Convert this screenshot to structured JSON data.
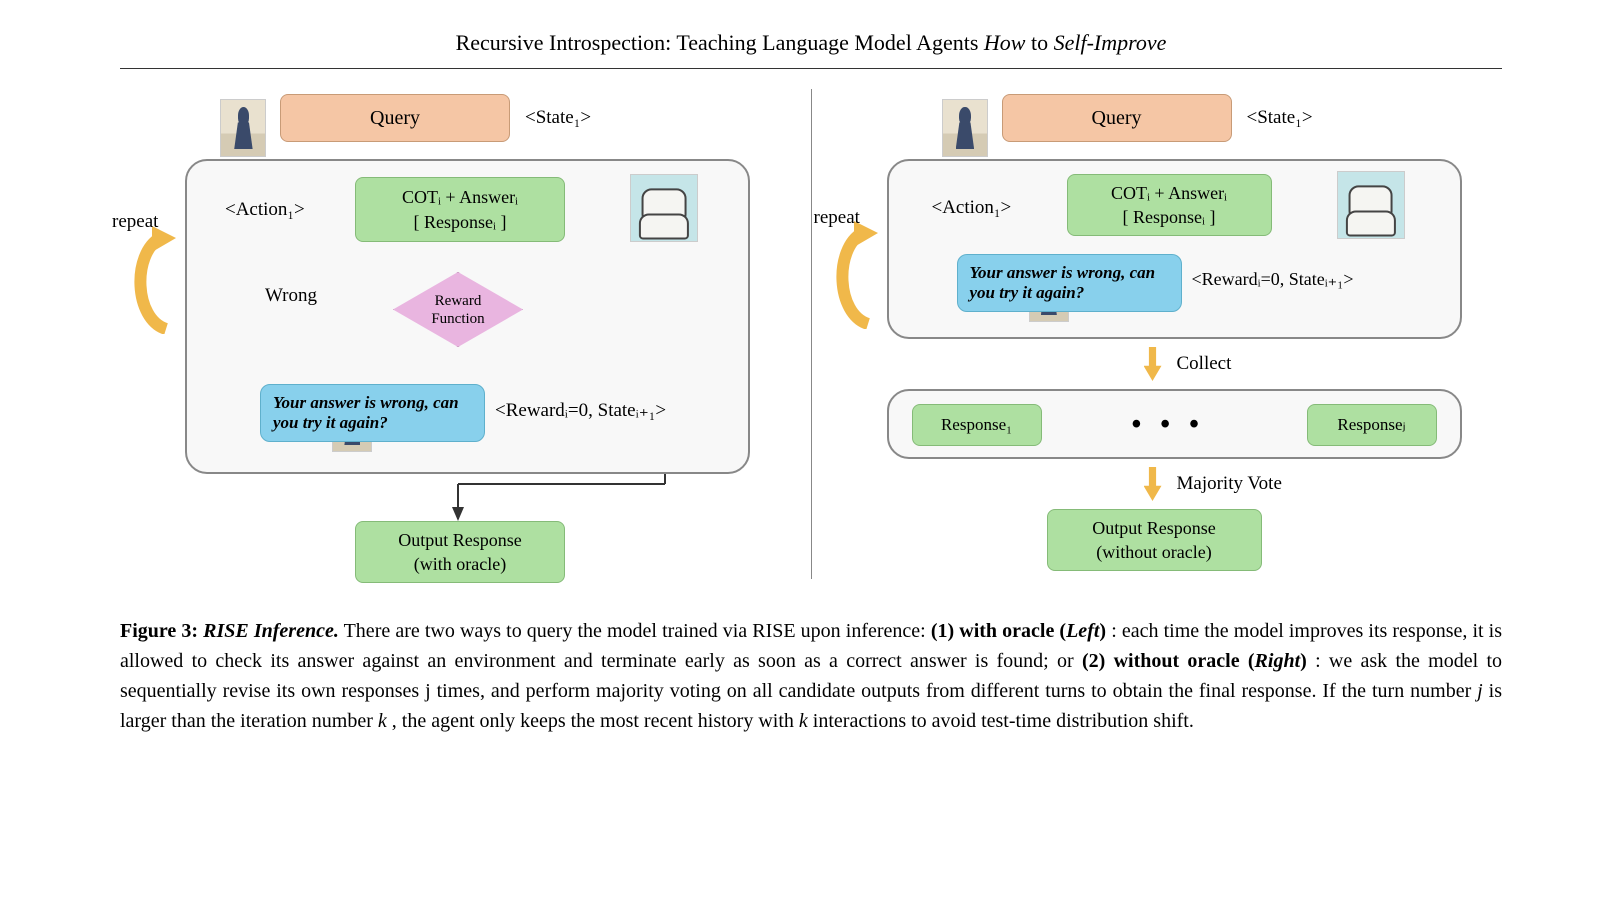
{
  "title": {
    "prefix": "Recursive Introspection: Teaching Language Model Agents ",
    "italic1": "How",
    "mid": " to ",
    "italic2": "Self-Improve"
  },
  "left": {
    "query": "Query",
    "state1": "<State₁>",
    "action": "<Action₁>",
    "cot_line1": "COTᵢ + Answerᵢ",
    "cot_line2": "[    Responseᵢ    ]",
    "reward_fn": "Reward\nFunction",
    "wrong": "Wrong",
    "feedback": "Your answer is wrong, can you try it again?",
    "reward_state": "<Rewardᵢ=0, Stateᵢ₊₁>",
    "repeat": "repeat",
    "output_line1": "Output Response",
    "output_line2": "(with oracle)"
  },
  "right": {
    "query": "Query",
    "state1": "<State₁>",
    "action": "<Action₁>",
    "cot_line1": "COTᵢ + Answerᵢ",
    "cot_line2": "[    Responseᵢ    ]",
    "feedback": "Your answer is wrong, can you try it again?",
    "reward_state": "<Rewardᵢ=0, Stateᵢ₊₁>",
    "repeat": "repeat",
    "collect": "Collect",
    "response1": "Response₁",
    "dots": "• • •",
    "responsej": "Responseⱼ",
    "majority": "Majority Vote",
    "output_line1": "Output Response",
    "output_line2": "(without oracle)"
  },
  "caption": {
    "fig": "Figure 3:",
    "subtitle": "RISE Inference.",
    "body1": " There are two ways to query the model trained via RISE upon inference: ",
    "b1": "(1) with oracle (",
    "i1": "Left",
    "b1b": ")",
    "body2": ": each time the model improves its response, it is allowed to check its answer against an environment and terminate early as soon as a correct answer is found; or ",
    "b2": "(2) without oracle (",
    "i2": "Right",
    "b2b": ")",
    "body3": ": we ask the model to sequentially revise its own responses j times, and perform majority voting on all candidate outputs from different turns to obtain the final response. If the turn number ",
    "m1": "j",
    "body4": " is larger than the iteration number ",
    "m2": "k",
    "body5": ", the agent only keeps the most recent history with ",
    "m3": "k",
    "body6": " interactions to avoid test-time distribution shift."
  }
}
